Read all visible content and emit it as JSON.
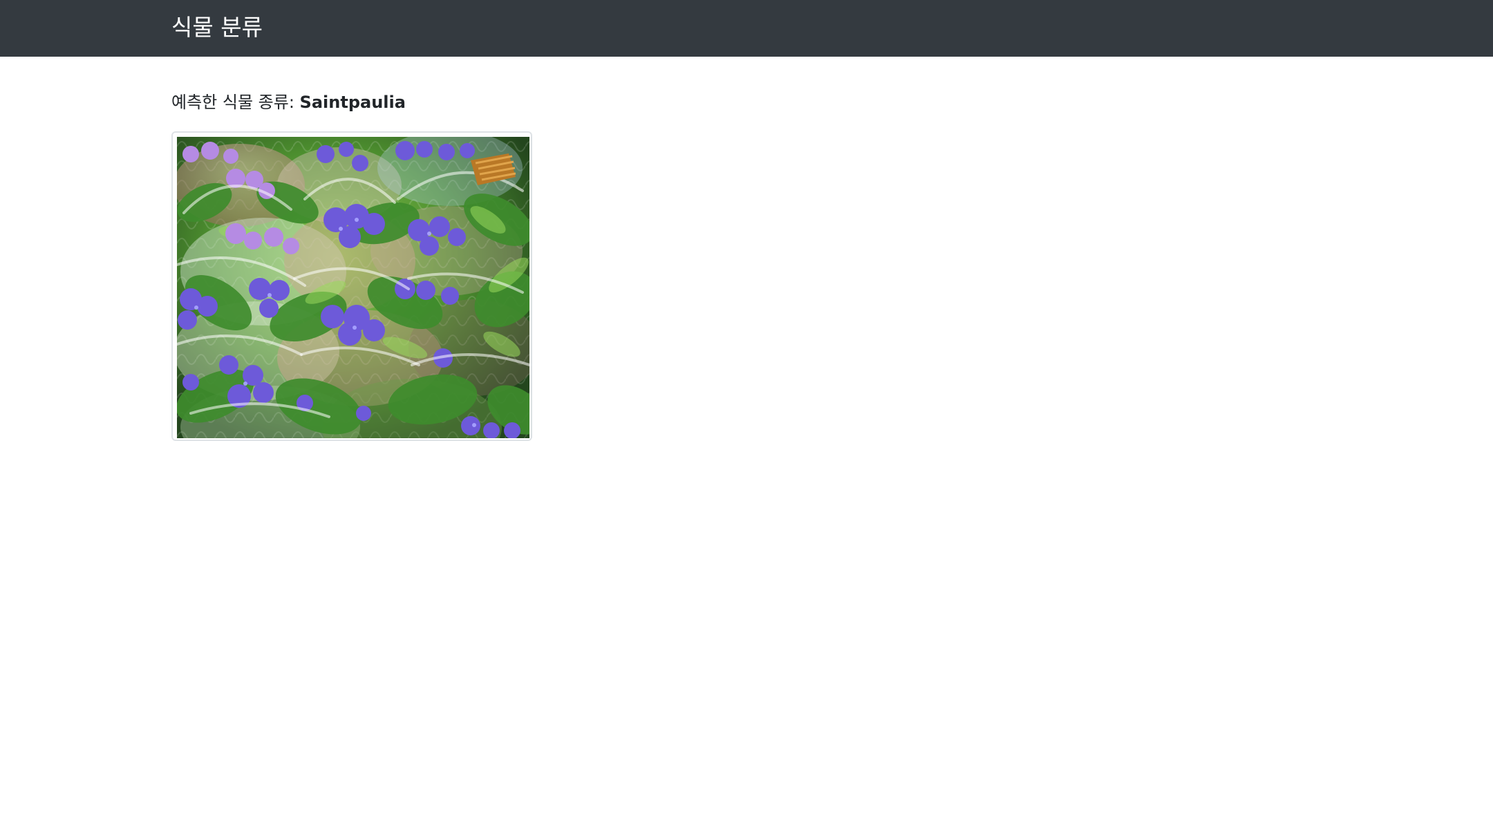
{
  "header": {
    "brand": "식물 분류"
  },
  "main": {
    "prediction_label": "예측한 식물 종류: ",
    "prediction_value": "Saintpaulia"
  },
  "image": {
    "alt": "Saintpaulia",
    "subject": "potted african violets"
  },
  "colors": {
    "navbar": "#343a40",
    "violet": "#7b63d6",
    "leaf": "#4d8f2f"
  }
}
